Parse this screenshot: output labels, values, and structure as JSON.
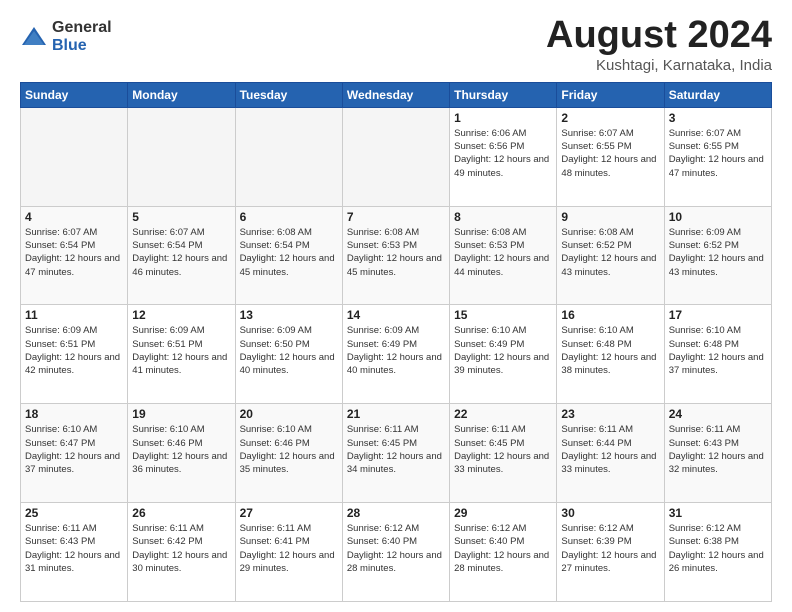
{
  "logo": {
    "general": "General",
    "blue": "Blue"
  },
  "title": "August 2024",
  "location": "Kushtagi, Karnataka, India",
  "days_of_week": [
    "Sunday",
    "Monday",
    "Tuesday",
    "Wednesday",
    "Thursday",
    "Friday",
    "Saturday"
  ],
  "weeks": [
    [
      {
        "day": "",
        "empty": true
      },
      {
        "day": "",
        "empty": true
      },
      {
        "day": "",
        "empty": true
      },
      {
        "day": "",
        "empty": true
      },
      {
        "day": "1",
        "sunrise": "6:06 AM",
        "sunset": "6:56 PM",
        "daylight": "12 hours and 49 minutes."
      },
      {
        "day": "2",
        "sunrise": "6:07 AM",
        "sunset": "6:55 PM",
        "daylight": "12 hours and 48 minutes."
      },
      {
        "day": "3",
        "sunrise": "6:07 AM",
        "sunset": "6:55 PM",
        "daylight": "12 hours and 47 minutes."
      }
    ],
    [
      {
        "day": "4",
        "sunrise": "6:07 AM",
        "sunset": "6:54 PM",
        "daylight": "12 hours and 47 minutes."
      },
      {
        "day": "5",
        "sunrise": "6:07 AM",
        "sunset": "6:54 PM",
        "daylight": "12 hours and 46 minutes."
      },
      {
        "day": "6",
        "sunrise": "6:08 AM",
        "sunset": "6:54 PM",
        "daylight": "12 hours and 45 minutes."
      },
      {
        "day": "7",
        "sunrise": "6:08 AM",
        "sunset": "6:53 PM",
        "daylight": "12 hours and 45 minutes."
      },
      {
        "day": "8",
        "sunrise": "6:08 AM",
        "sunset": "6:53 PM",
        "daylight": "12 hours and 44 minutes."
      },
      {
        "day": "9",
        "sunrise": "6:08 AM",
        "sunset": "6:52 PM",
        "daylight": "12 hours and 43 minutes."
      },
      {
        "day": "10",
        "sunrise": "6:09 AM",
        "sunset": "6:52 PM",
        "daylight": "12 hours and 43 minutes."
      }
    ],
    [
      {
        "day": "11",
        "sunrise": "6:09 AM",
        "sunset": "6:51 PM",
        "daylight": "12 hours and 42 minutes."
      },
      {
        "day": "12",
        "sunrise": "6:09 AM",
        "sunset": "6:51 PM",
        "daylight": "12 hours and 41 minutes."
      },
      {
        "day": "13",
        "sunrise": "6:09 AM",
        "sunset": "6:50 PM",
        "daylight": "12 hours and 40 minutes."
      },
      {
        "day": "14",
        "sunrise": "6:09 AM",
        "sunset": "6:49 PM",
        "daylight": "12 hours and 40 minutes."
      },
      {
        "day": "15",
        "sunrise": "6:10 AM",
        "sunset": "6:49 PM",
        "daylight": "12 hours and 39 minutes."
      },
      {
        "day": "16",
        "sunrise": "6:10 AM",
        "sunset": "6:48 PM",
        "daylight": "12 hours and 38 minutes."
      },
      {
        "day": "17",
        "sunrise": "6:10 AM",
        "sunset": "6:48 PM",
        "daylight": "12 hours and 37 minutes."
      }
    ],
    [
      {
        "day": "18",
        "sunrise": "6:10 AM",
        "sunset": "6:47 PM",
        "daylight": "12 hours and 37 minutes."
      },
      {
        "day": "19",
        "sunrise": "6:10 AM",
        "sunset": "6:46 PM",
        "daylight": "12 hours and 36 minutes."
      },
      {
        "day": "20",
        "sunrise": "6:10 AM",
        "sunset": "6:46 PM",
        "daylight": "12 hours and 35 minutes."
      },
      {
        "day": "21",
        "sunrise": "6:11 AM",
        "sunset": "6:45 PM",
        "daylight": "12 hours and 34 minutes."
      },
      {
        "day": "22",
        "sunrise": "6:11 AM",
        "sunset": "6:45 PM",
        "daylight": "12 hours and 33 minutes."
      },
      {
        "day": "23",
        "sunrise": "6:11 AM",
        "sunset": "6:44 PM",
        "daylight": "12 hours and 33 minutes."
      },
      {
        "day": "24",
        "sunrise": "6:11 AM",
        "sunset": "6:43 PM",
        "daylight": "12 hours and 32 minutes."
      }
    ],
    [
      {
        "day": "25",
        "sunrise": "6:11 AM",
        "sunset": "6:43 PM",
        "daylight": "12 hours and 31 minutes."
      },
      {
        "day": "26",
        "sunrise": "6:11 AM",
        "sunset": "6:42 PM",
        "daylight": "12 hours and 30 minutes."
      },
      {
        "day": "27",
        "sunrise": "6:11 AM",
        "sunset": "6:41 PM",
        "daylight": "12 hours and 29 minutes."
      },
      {
        "day": "28",
        "sunrise": "6:12 AM",
        "sunset": "6:40 PM",
        "daylight": "12 hours and 28 minutes."
      },
      {
        "day": "29",
        "sunrise": "6:12 AM",
        "sunset": "6:40 PM",
        "daylight": "12 hours and 28 minutes."
      },
      {
        "day": "30",
        "sunrise": "6:12 AM",
        "sunset": "6:39 PM",
        "daylight": "12 hours and 27 minutes."
      },
      {
        "day": "31",
        "sunrise": "6:12 AM",
        "sunset": "6:38 PM",
        "daylight": "12 hours and 26 minutes."
      }
    ]
  ]
}
